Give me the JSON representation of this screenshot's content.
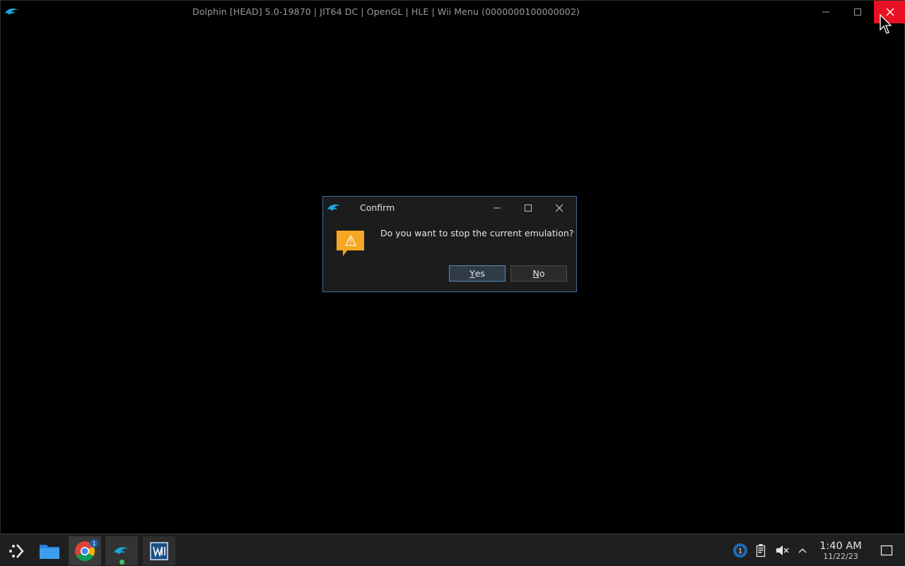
{
  "window": {
    "title": "Dolphin [HEAD] 5.0-19870 | JIT64 DC | OpenGL | HLE | Wii Menu (0000000100000002)"
  },
  "dialog": {
    "title": "Confirm",
    "message": "Do you want to stop the current emulation?",
    "yes_first": "Y",
    "yes_rest": "es",
    "no_first": "N",
    "no_rest": "o"
  },
  "taskbar": {
    "items": [
      "start-icon",
      "files-icon",
      "chrome-icon",
      "dolphin-icon",
      "wm-icon"
    ],
    "chrome_badge": "1",
    "steam_badge": "1"
  },
  "clock": {
    "time": "1:40 AM",
    "date": "11/22/23"
  },
  "colors": {
    "close_red": "#e81123",
    "dialog_border": "#3d6b9a",
    "warning_orange": "#f5a623",
    "dolphin_blue": "#1ba6e0"
  }
}
